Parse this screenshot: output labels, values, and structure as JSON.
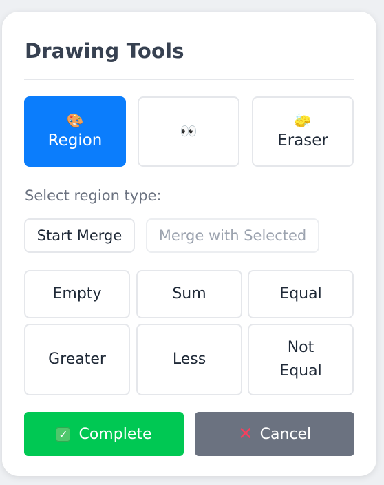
{
  "panel": {
    "title": "Drawing Tools"
  },
  "tools": [
    {
      "id": "region",
      "label": "Region",
      "icon": "🎨",
      "icon_name": "palette-icon",
      "active": true
    },
    {
      "id": "eyes",
      "label": "",
      "icon": "👀",
      "icon_name": "eyes-icon",
      "active": false
    },
    {
      "id": "eraser",
      "label": "Eraser",
      "icon": "🧽",
      "icon_name": "sponge-icon",
      "active": false
    }
  ],
  "region_type": {
    "prompt": "Select region type:",
    "start_merge_label": "Start Merge",
    "merge_with_selected_label": "Merge with Selected",
    "types": [
      "Empty",
      "Sum",
      "Equal",
      "Greater",
      "Less",
      "Not Equal"
    ]
  },
  "actions": {
    "complete_label": "Complete",
    "complete_icon": "✓",
    "cancel_label": "Cancel",
    "cancel_icon": "✕"
  },
  "colors": {
    "accent": "#0b7dfc",
    "complete": "#00c853",
    "cancel": "#6b7280",
    "title": "#374151"
  }
}
